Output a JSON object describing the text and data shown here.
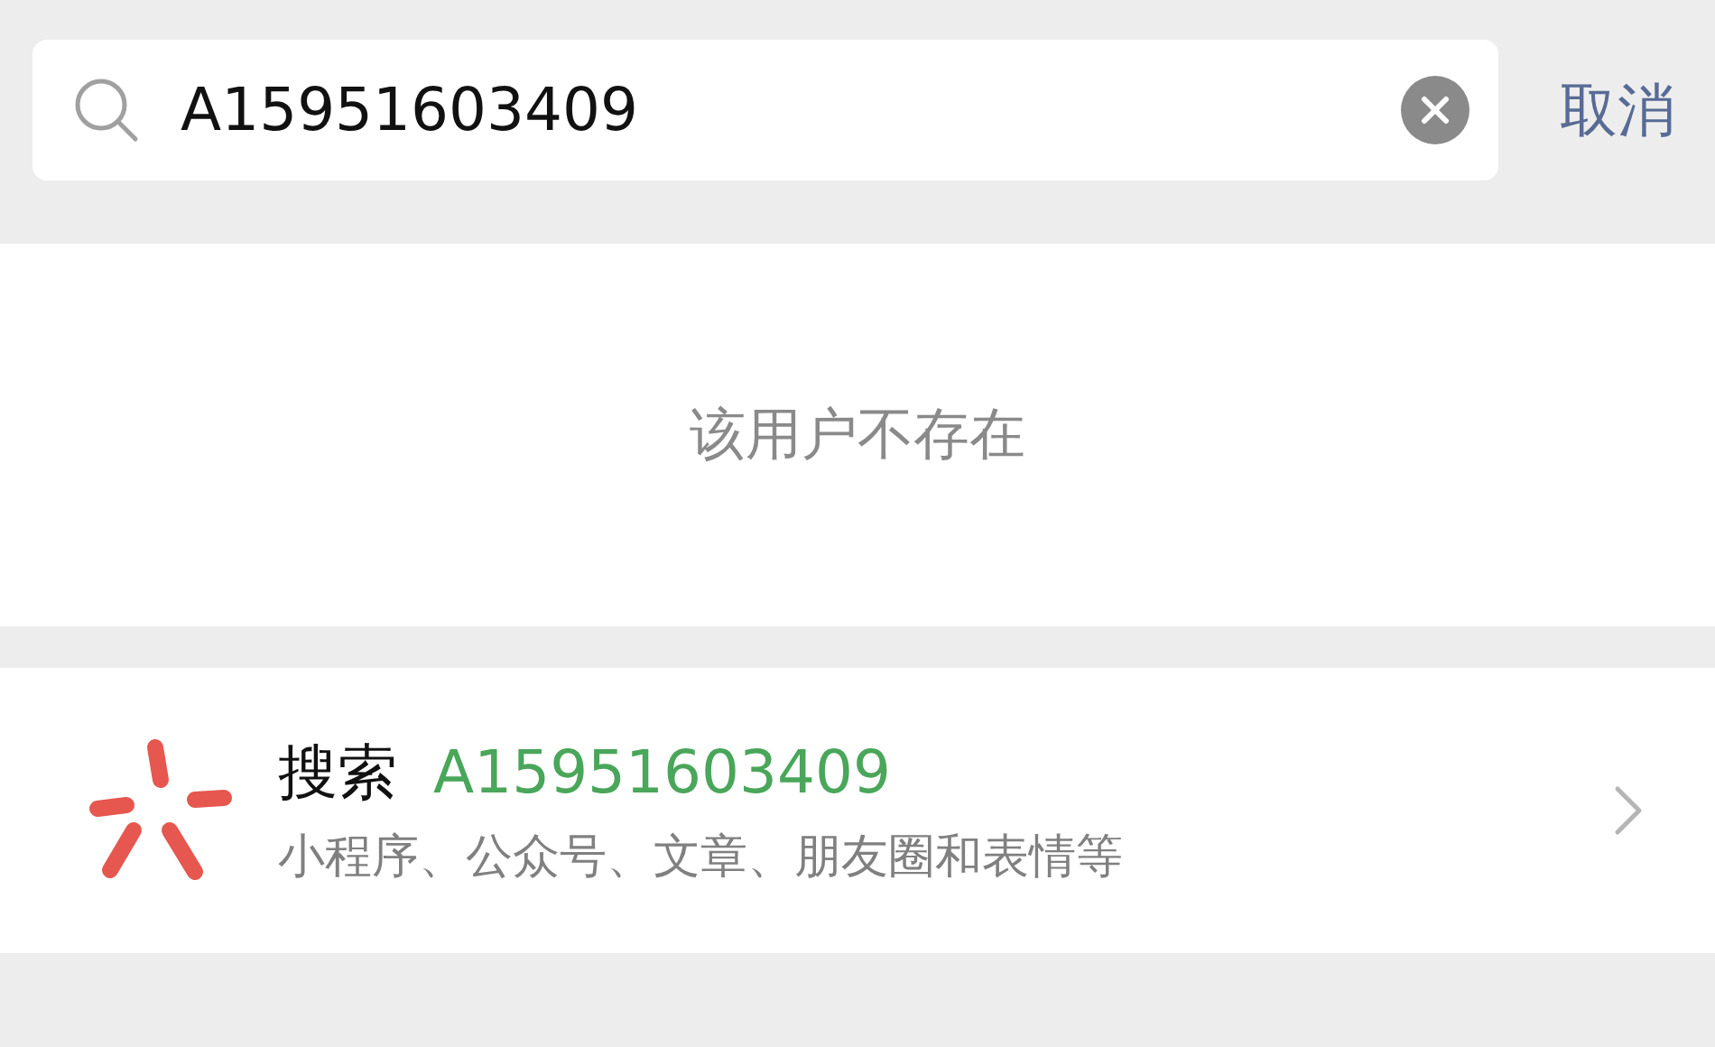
{
  "search": {
    "value": "A15951603409",
    "cancel": "取消"
  },
  "empty_message": "该用户不存在",
  "search_suggestion": {
    "label": "搜索",
    "query": "A15951603409",
    "description": "小程序、公众号、文章、朋友圈和表情等"
  }
}
